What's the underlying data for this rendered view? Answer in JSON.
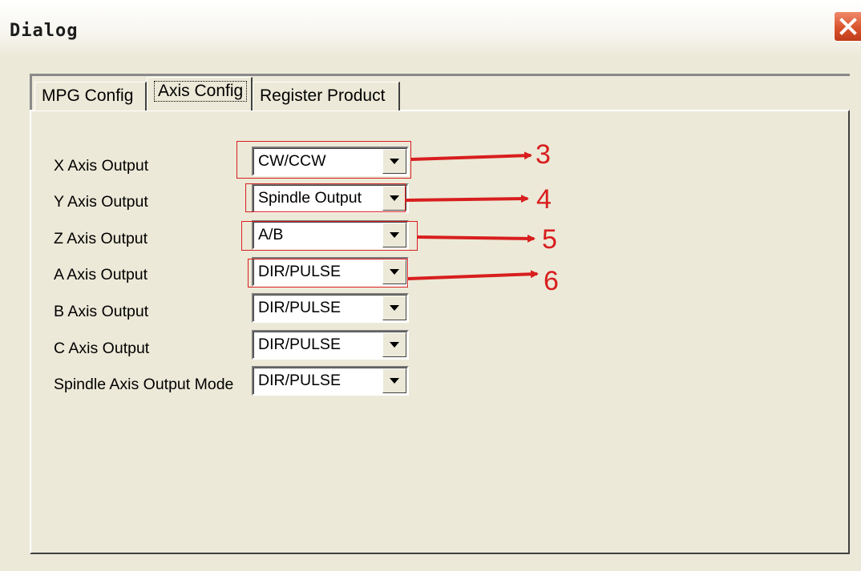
{
  "window": {
    "title": "Dialog"
  },
  "tabs": [
    {
      "label": "MPG Config",
      "active": false
    },
    {
      "label": "Axis Config",
      "active": true
    },
    {
      "label": "Register Product",
      "active": false
    }
  ],
  "rows": [
    {
      "label": "X Axis Output",
      "value": "CW/CCW"
    },
    {
      "label": "Y Axis Output",
      "value": "Spindle Output"
    },
    {
      "label": "Z Axis Output",
      "value": "A/B"
    },
    {
      "label": "A Axis Output",
      "value": "DIR/PULSE"
    },
    {
      "label": "B Axis Output",
      "value": "DIR/PULSE"
    },
    {
      "label": "C Axis Output",
      "value": "DIR/PULSE"
    },
    {
      "label": "Spindle Axis Output Mode",
      "value": "DIR/PULSE"
    }
  ],
  "annotations": [
    {
      "number": "3"
    },
    {
      "number": "4"
    },
    {
      "number": "5"
    },
    {
      "number": "6"
    }
  ],
  "colors": {
    "annotation": "#d81e1e",
    "window_bg": "#ece9d8",
    "close_button": "#d9532c"
  },
  "icons": {
    "close": "close-icon",
    "dropdown": "chevron-down-icon"
  }
}
